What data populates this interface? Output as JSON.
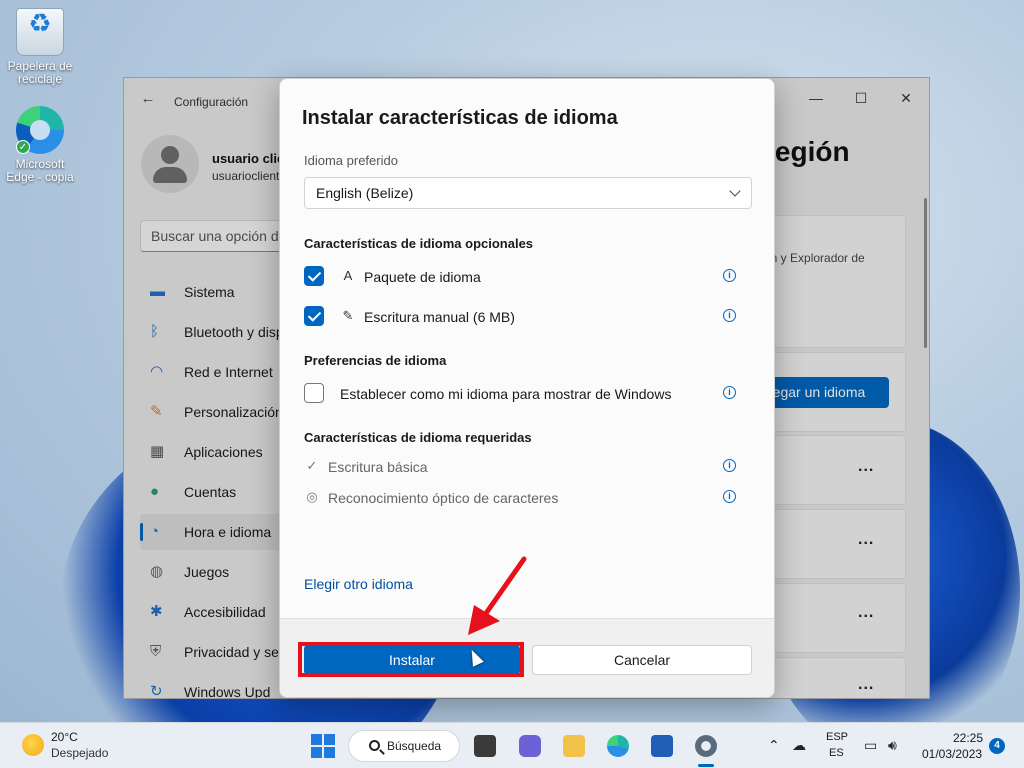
{
  "desktop": {
    "icons": [
      {
        "label": "Papelera de reciclaje",
        "icon": "recycle-bin-icon"
      },
      {
        "label": "Microsoft Edge - copia",
        "icon": "edge-icon"
      }
    ]
  },
  "settings": {
    "window_title": "Configuración",
    "user_name": "usuario clie",
    "user_email": "usuarioclient",
    "search_placeholder": "Buscar una opción de",
    "page_title": "región",
    "panel_text": "ón y Explorador de",
    "add_language_label": "regar un idioma",
    "nav_items": [
      {
        "label": "Sistema",
        "icon": "monitor-icon",
        "color": "#1f6fc6"
      },
      {
        "label": "Bluetooth y disp",
        "icon": "bluetooth-icon",
        "color": "#1f6fc6"
      },
      {
        "label": "Red e Internet",
        "icon": "wifi-icon",
        "color": "#1f6fc6"
      },
      {
        "label": "Personalización",
        "icon": "brush-icon",
        "color": "#d9792b"
      },
      {
        "label": "Aplicaciones",
        "icon": "apps-icon",
        "color": "#555555"
      },
      {
        "label": "Cuentas",
        "icon": "person-icon",
        "color": "#2a9d6a"
      },
      {
        "label": "Hora e idioma",
        "icon": "clock-globe-icon",
        "color": "#1f6fc6",
        "active": true
      },
      {
        "label": "Juegos",
        "icon": "gamepad-icon",
        "color": "#666666"
      },
      {
        "label": "Accesibilidad",
        "icon": "accessibility-icon",
        "color": "#1f6fc6"
      },
      {
        "label": "Privacidad y seg",
        "icon": "shield-icon",
        "color": "#666666"
      },
      {
        "label": "Windows Upd",
        "icon": "update-icon",
        "color": "#1f6fc6"
      }
    ],
    "more_label": "..."
  },
  "dialog": {
    "title": "Instalar características de idioma",
    "preferred_label": "Idioma preferido",
    "preferred_value": "English (Belize)",
    "optional_heading": "Características de idioma opcionales",
    "optional_features": [
      {
        "label": "Paquete de idioma",
        "icon": "language-pack-icon",
        "checked": true
      },
      {
        "label": "Escritura manual (6 MB)",
        "icon": "handwriting-icon",
        "checked": true
      }
    ],
    "preferences_heading": "Preferencias de idioma",
    "display_language_label": "Establecer como mi idioma para mostrar de Windows",
    "display_language_checked": false,
    "required_heading": "Características de idioma requeridas",
    "required_features": [
      {
        "label": "Escritura básica",
        "icon": "spellcheck-icon"
      },
      {
        "label": "Reconocimiento óptico de caracteres",
        "icon": "camera-icon"
      }
    ],
    "choose_other_link": "Elegir otro idioma",
    "install_label": "Instalar",
    "cancel_label": "Cancelar",
    "info_glyph": "i"
  },
  "taskbar": {
    "temperature": "20°C",
    "weather": "Despejado",
    "search_label": "Búsqueda",
    "lang_top": "ESP",
    "lang_bottom": "ES",
    "time": "22:25",
    "date": "01/03/2023",
    "notifications": "4"
  },
  "colors": {
    "accent": "#0067c0",
    "highlight": "#e8101a"
  }
}
